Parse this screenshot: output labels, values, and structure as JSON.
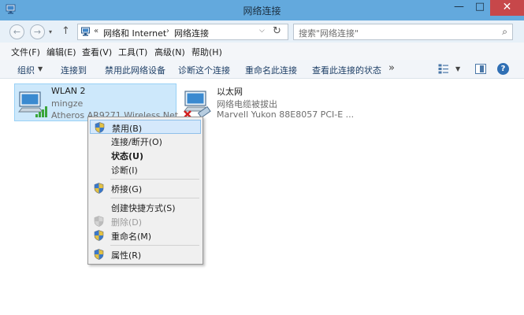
{
  "window": {
    "title": "网络连接"
  },
  "controls": {
    "minimize": "—",
    "maximize": "□",
    "close": "✕"
  },
  "nav": {
    "back": "←",
    "forward": "→",
    "dropdown": "▾",
    "up": "↑"
  },
  "address": {
    "prefix": "«",
    "crumb1": "网络和 Internet",
    "sep": "›",
    "crumb2": "网络连接",
    "dropdown": "⌵",
    "refresh": "↻"
  },
  "search": {
    "placeholder": "搜索\"网络连接\"",
    "icon": "⌕"
  },
  "menu": {
    "file": "文件(F)",
    "edit": "编辑(E)",
    "view": "查看(V)",
    "tools": "工具(T)",
    "advanced": "高级(N)",
    "help": "帮助(H)"
  },
  "commands": {
    "organize": "组织",
    "organize_arrow": "▼",
    "connect_to": "连接到",
    "disable_device": "禁用此网络设备",
    "diagnose": "诊断这个连接",
    "rename": "重命名此连接",
    "view_status": "查看此连接的状态",
    "more": "»",
    "view_arrow": "▼",
    "help": "?"
  },
  "connections": [
    {
      "name": "WLAN 2",
      "sub": "mingze",
      "device": "Atheros AR9271 Wireless Net..."
    },
    {
      "name": "以太网",
      "sub": "网络电缆被拔出",
      "device": "Marvell Yukon 88E8057 PCI-E ..."
    }
  ],
  "context_menu": {
    "items": [
      {
        "label": "禁用(B)"
      },
      {
        "label": "连接/断开(O)"
      },
      {
        "label": "状态(U)"
      },
      {
        "label": "诊断(I)"
      },
      {
        "label": "桥接(G)"
      },
      {
        "label": "创建快捷方式(S)"
      },
      {
        "label": "删除(D)"
      },
      {
        "label": "重命名(M)"
      },
      {
        "label": "属性(R)"
      }
    ]
  },
  "colors": {
    "titlebar": "#63a9dd",
    "close_button": "#c7474a",
    "selection": "#cde8fb",
    "signal": "#3aa53a",
    "error": "#d22020"
  }
}
